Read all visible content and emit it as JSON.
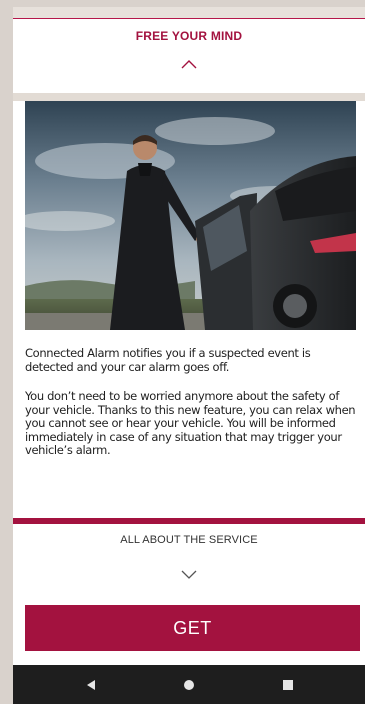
{
  "section": {
    "title": "FREE YOUR MIND",
    "collapse_icon": "chevron-up-icon"
  },
  "hero": {
    "image": "man-in-coat-beside-car-photo"
  },
  "content": {
    "paragraph_1": "Connected Alarm notifies you if a suspected event is detected and your car alarm goes off.",
    "paragraph_2": "You don’t need to be worried anymore about the safety of your vehicle. Thanks to this new feature, you can relax when you cannot see or hear your vehicle. You will be informed immediately in case of any situation that may trigger your vehicle’s alarm."
  },
  "service": {
    "label": "ALL ABOUT THE SERVICE",
    "expand_icon": "chevron-down-icon"
  },
  "cta": {
    "label": "GET"
  },
  "nav": {
    "back_icon": "back-triangle-icon",
    "home_icon": "home-circle-icon",
    "recent_icon": "recent-square-icon"
  },
  "colors": {
    "accent": "#a3123f",
    "background": "#d9d2cc",
    "navbar": "#1e1e1e"
  }
}
